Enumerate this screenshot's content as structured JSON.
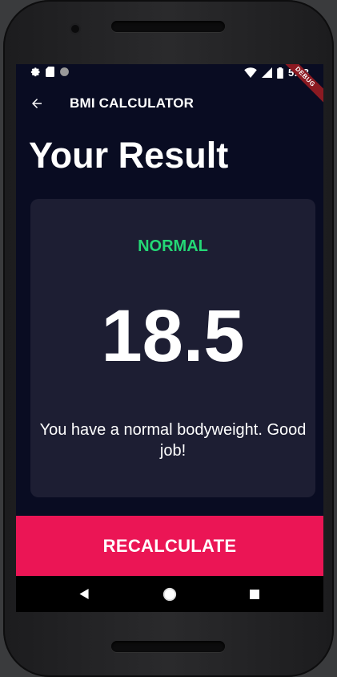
{
  "status_bar": {
    "time": "5:43",
    "debug_label": "DEBUG"
  },
  "app_bar": {
    "title": "BMI CALCULATOR"
  },
  "page": {
    "title": "Your Result"
  },
  "result": {
    "status": "NORMAL",
    "status_color": "#24d876",
    "bmi": "18.5",
    "message": "You have a normal bodyweight. Good job!"
  },
  "button": {
    "label": "RECALCULATE",
    "color": "#eb1555"
  },
  "colors": {
    "background": "#090c22",
    "card": "#1d1e33"
  },
  "icons": [
    "gear-icon",
    "sd-card-icon",
    "circle-icon",
    "wifi-icon",
    "signal-icon",
    "battery-icon",
    "back-arrow-icon",
    "nav-back-icon",
    "nav-home-icon",
    "nav-recent-icon"
  ]
}
